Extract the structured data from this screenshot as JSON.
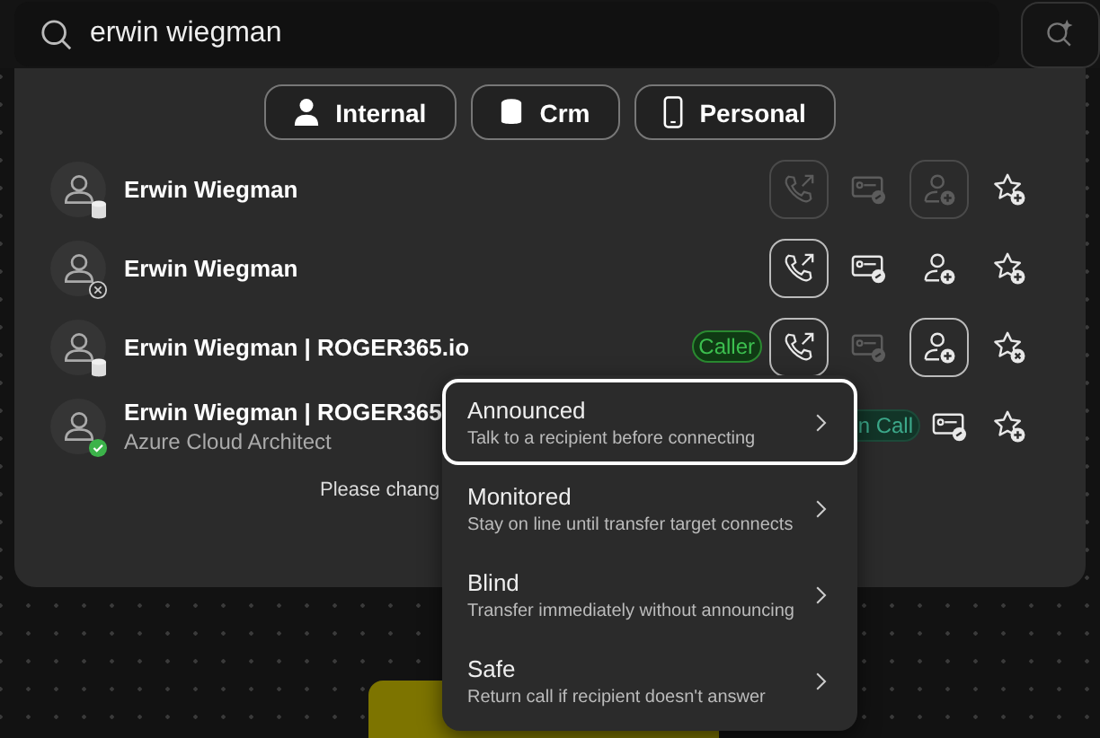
{
  "search": {
    "value": "erwin wiegman"
  },
  "filters": [
    {
      "label": "Internal",
      "kind": "person"
    },
    {
      "label": "Crm",
      "kind": "database"
    },
    {
      "label": "Personal",
      "kind": "phone"
    }
  ],
  "contacts": [
    {
      "name": "Erwin Wiegman",
      "kind": "crm",
      "actions": [
        {
          "kind": "transfer",
          "disabled": true,
          "outlined": true
        },
        {
          "kind": "card",
          "disabled": true,
          "outlined": false
        },
        {
          "kind": "add-contact",
          "disabled": true,
          "outlined": true
        },
        {
          "kind": "favorite-add",
          "disabled": false,
          "outlined": false
        }
      ]
    },
    {
      "name": "Erwin Wiegman",
      "kind": "removed",
      "actions": [
        {
          "kind": "transfer",
          "disabled": false,
          "outlined": true
        },
        {
          "kind": "card",
          "disabled": false,
          "outlined": false
        },
        {
          "kind": "add-contact",
          "disabled": false,
          "outlined": false
        },
        {
          "kind": "favorite-add",
          "disabled": false,
          "outlined": false
        }
      ]
    },
    {
      "name": "Erwin Wiegman | ROGER365.io",
      "kind": "crm",
      "badge": "Caller",
      "actions": [
        {
          "kind": "transfer",
          "disabled": false,
          "outlined": true
        },
        {
          "kind": "card",
          "disabled": true,
          "outlined": false
        },
        {
          "kind": "add-contact",
          "disabled": false,
          "outlined": true
        },
        {
          "kind": "favorite-remove",
          "disabled": false,
          "outlined": false
        }
      ]
    },
    {
      "name": "Erwin Wiegman | ROGER365",
      "subtitle": "Azure Cloud Architect",
      "kind": "online",
      "badge": "n Call",
      "actions": [
        {
          "kind": "card",
          "disabled": false,
          "outlined": false
        },
        {
          "kind": "favorite-add",
          "disabled": false,
          "outlined": false
        }
      ]
    }
  ],
  "notice": "Please chang",
  "transfer_menu": [
    {
      "title": "Announced",
      "description": "Talk to a recipient before connecting",
      "selected": true
    },
    {
      "title": "Monitored",
      "description": "Stay on line until transfer target connects",
      "selected": false
    },
    {
      "title": "Blind",
      "description": "Transfer immediately without announcing",
      "selected": false
    },
    {
      "title": "Safe",
      "description": "Return call if recipient doesn't answer",
      "selected": false
    }
  ]
}
